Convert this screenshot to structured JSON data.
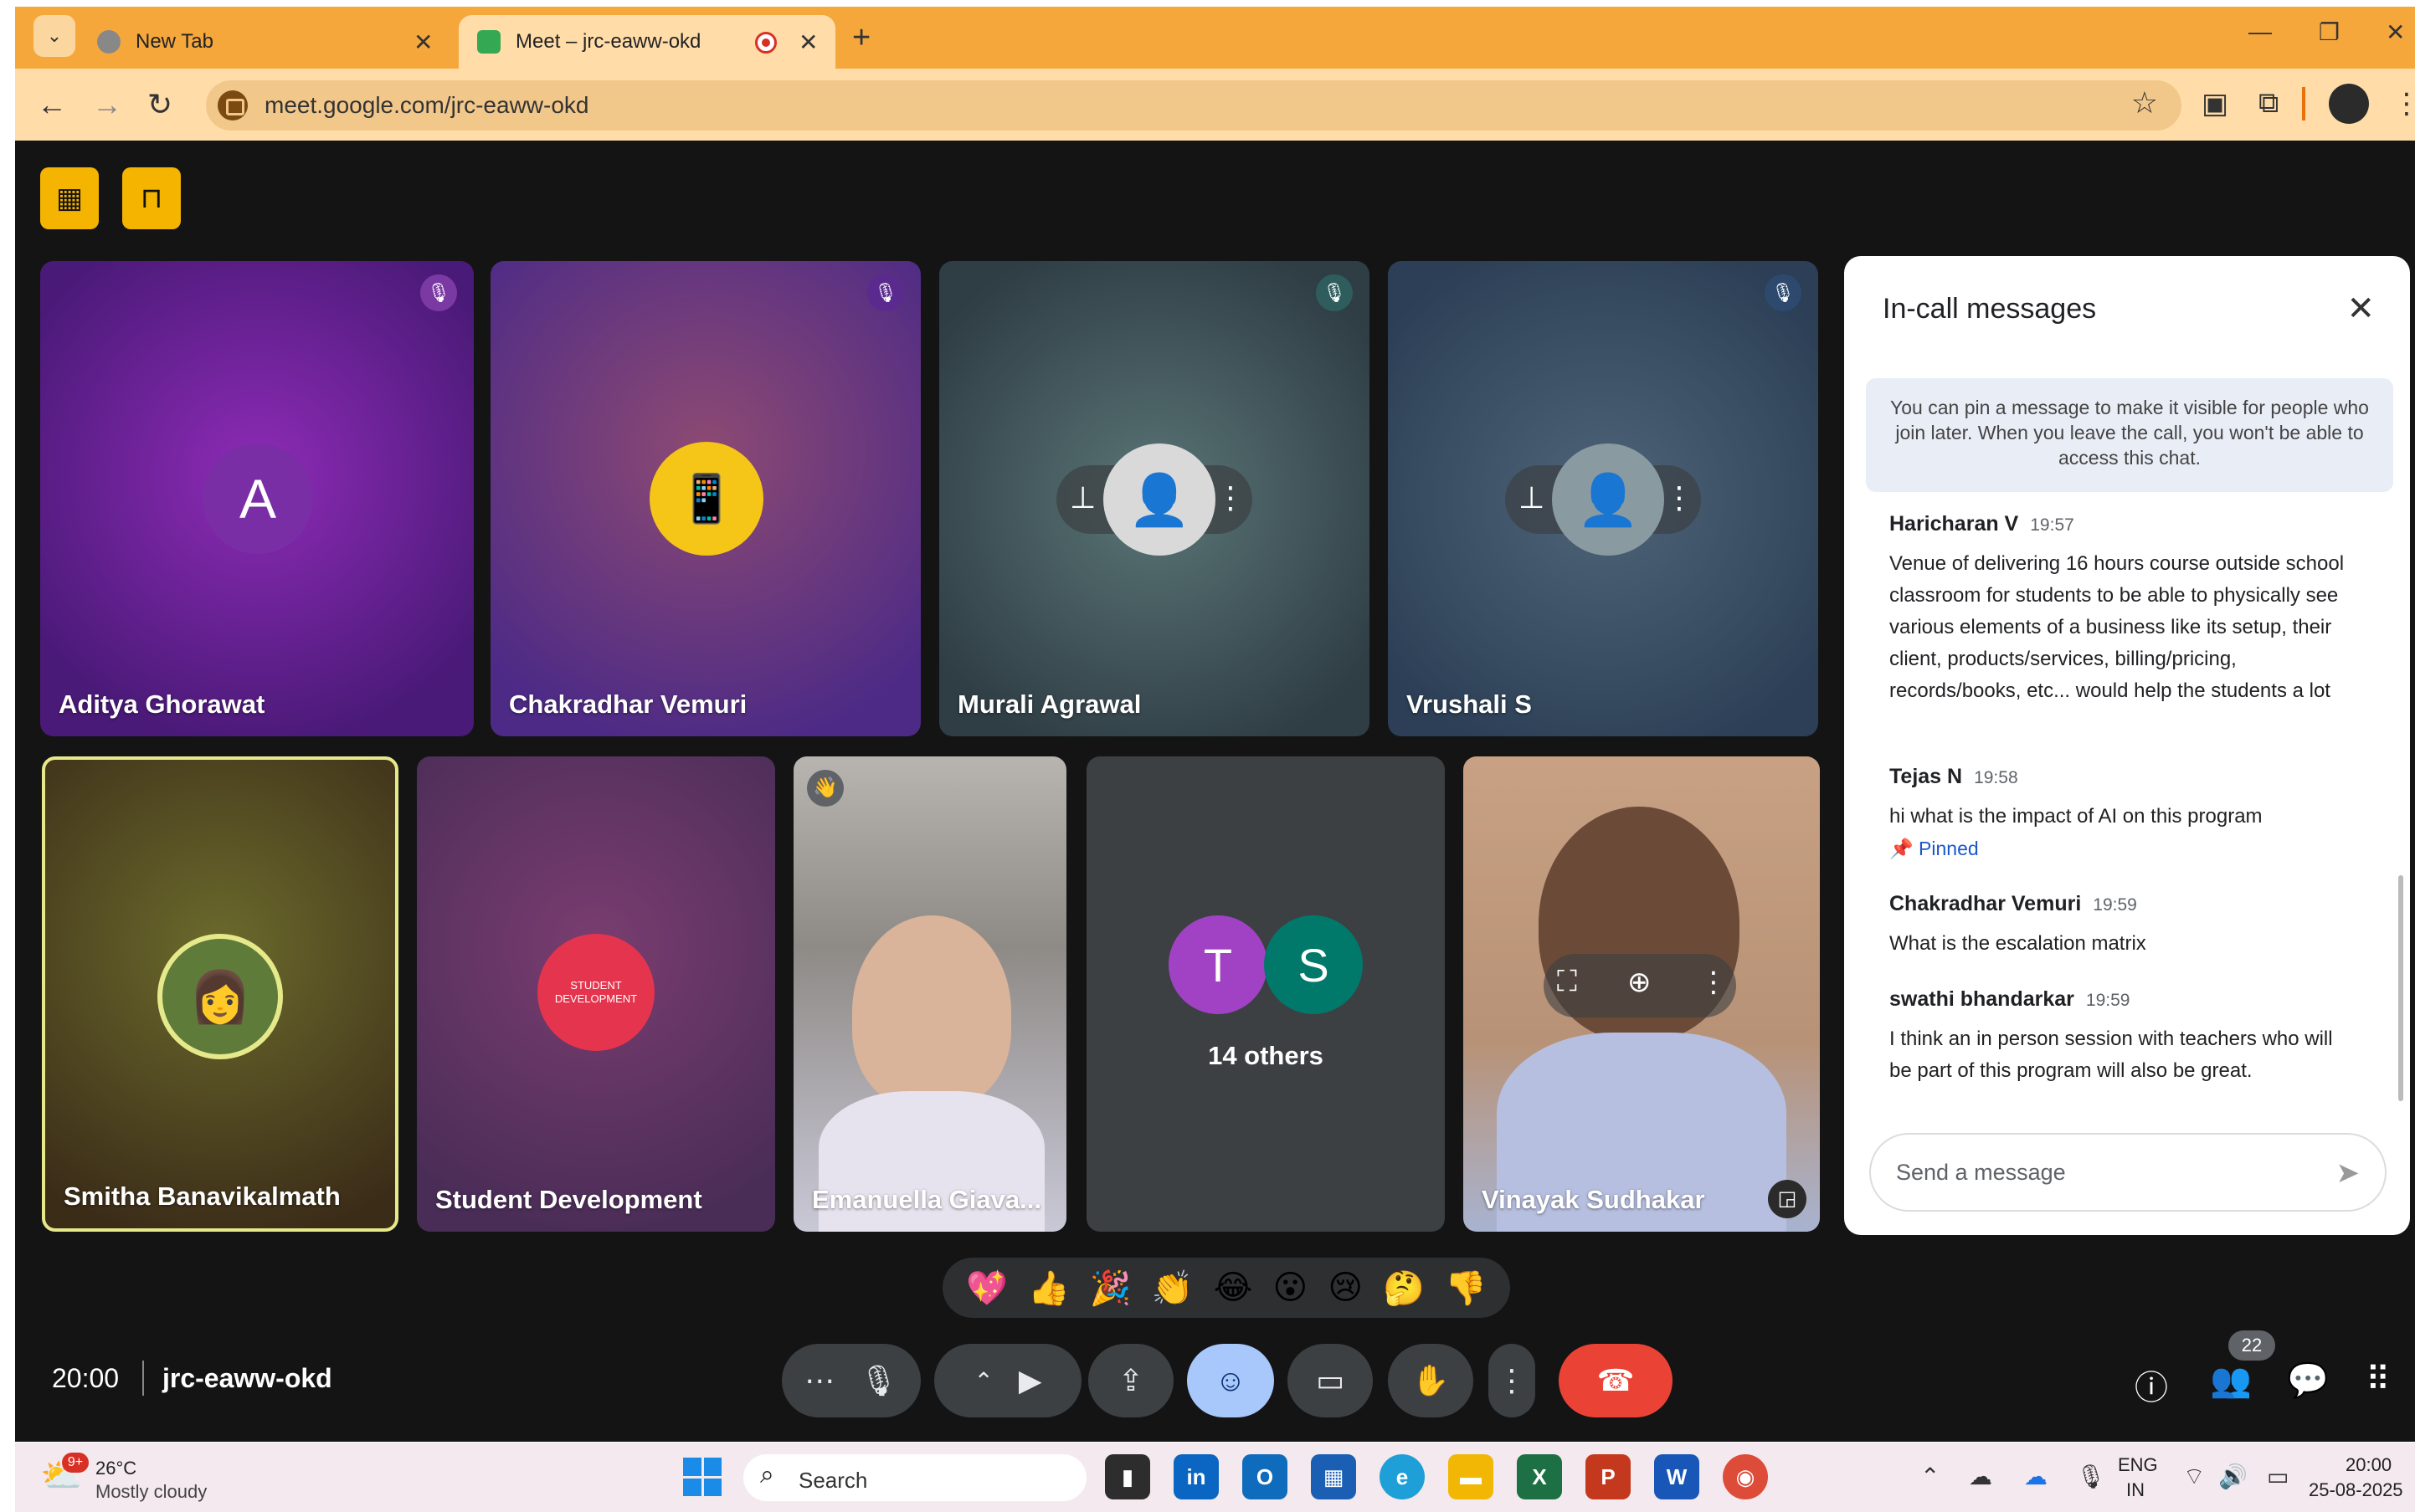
{
  "browser": {
    "tabs": [
      {
        "title": "New Tab",
        "active": false
      },
      {
        "title": "Meet – jrc-eaww-okd",
        "active": true
      }
    ],
    "url": "meet.google.com/jrc-eaww-okd"
  },
  "meet": {
    "participants_top": [
      {
        "name": "Aditya Ghorawat",
        "initial": "A",
        "muted": true
      },
      {
        "name": "Chakradhar Vemuri",
        "muted": true
      },
      {
        "name": "Murali Agrawal",
        "muted": true
      },
      {
        "name": "Vrushali S",
        "muted": true
      }
    ],
    "participants_bottom": [
      {
        "name": "Smitha Banavikalmath"
      },
      {
        "name": "Student Development",
        "logo_text": "STUDENT DEVELOPMENT"
      },
      {
        "name": "Emanuella Giava..."
      },
      {
        "name": "14 others",
        "initials": [
          "T",
          "S"
        ]
      },
      {
        "name": "Vinayak Sudhakar"
      }
    ],
    "chat": {
      "title": "In-call messages",
      "note": "You can pin a message to make it visible for people who join later. When you leave the call, you won't be able to access this chat.",
      "messages": [
        {
          "sender": "Haricharan V",
          "time": "19:57",
          "text": "Venue of delivering 16 hours course outside school classroom for students to be able to physically see various elements of a business like its setup, their client, products/services, billing/pricing, records/books, etc...  would help the students a lot"
        },
        {
          "sender": "Tejas N",
          "time": "19:58",
          "text": "hi what is the impact of AI on this program",
          "pinned_label": "Pinned"
        },
        {
          "sender": "Chakradhar Vemuri",
          "time": "19:59",
          "text": "What is the escalation matrix"
        },
        {
          "sender": "swathi bhandarkar",
          "time": "19:59",
          "text": "I think an in person session with teachers who will be part of this program will also be great."
        }
      ],
      "input_placeholder": "Send a message"
    },
    "reactions": [
      "💖",
      "👍",
      "🎉",
      "👏",
      "😂",
      "😮",
      "😢",
      "🤔",
      "👎"
    ],
    "clock": "20:00",
    "meeting_code": "jrc-eaww-okd",
    "participant_count": "22"
  },
  "taskbar": {
    "weather_temp": "26°C",
    "weather_desc": "Mostly cloudy",
    "weather_badge": "9+",
    "search_placeholder": "Search",
    "lang_line1": "ENG",
    "lang_line2": "IN",
    "time": "20:00",
    "date": "25-08-2025"
  },
  "colors": {
    "tab_strip": "#f6a73c",
    "meet_background": "#141414",
    "end_call": "#ea4335",
    "accent_yellow": "#f4b400"
  }
}
